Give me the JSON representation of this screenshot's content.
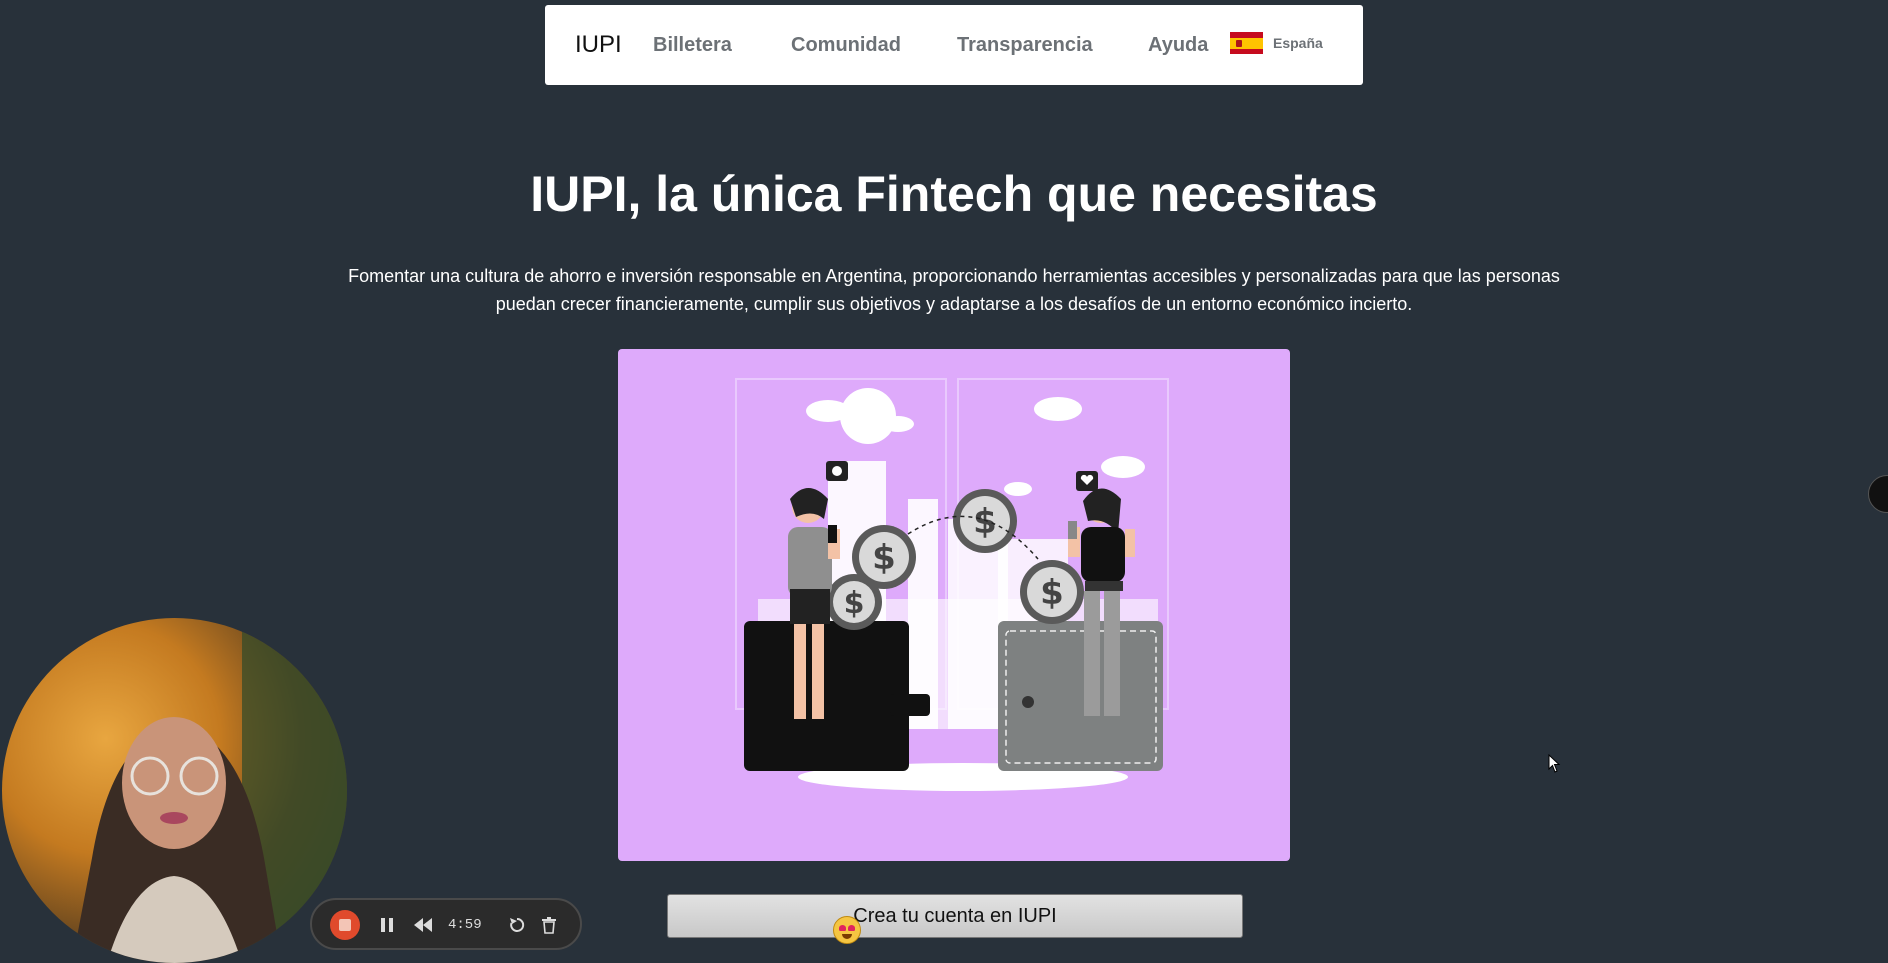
{
  "nav": {
    "logo": "IUPI",
    "links": [
      "Billetera",
      "Comunidad",
      "Transparencia",
      "Ayuda"
    ],
    "language": "España",
    "flag_icon": "spain-flag-icon"
  },
  "hero": {
    "title": "IUPI, la única Fintech que necesitas",
    "subtitle": "Fomentar una cultura de ahorro e inversión responsable en Argentina, proporcionando herramientas accesibles y personalizadas para que las personas puedan crecer financieramente, cumplir sus objetivos y adaptarse a los desafíos de un entorno económico incierto.",
    "illustration_bg": "#deaafb"
  },
  "cta": {
    "label": "Crea tu cuenta en IUPI"
  },
  "recorder": {
    "time": "4:59",
    "stop_color": "#e04a2c"
  },
  "colors": {
    "page_bg": "#28313a",
    "nav_bg": "#ffffff",
    "nav_text": "#6c7176"
  }
}
